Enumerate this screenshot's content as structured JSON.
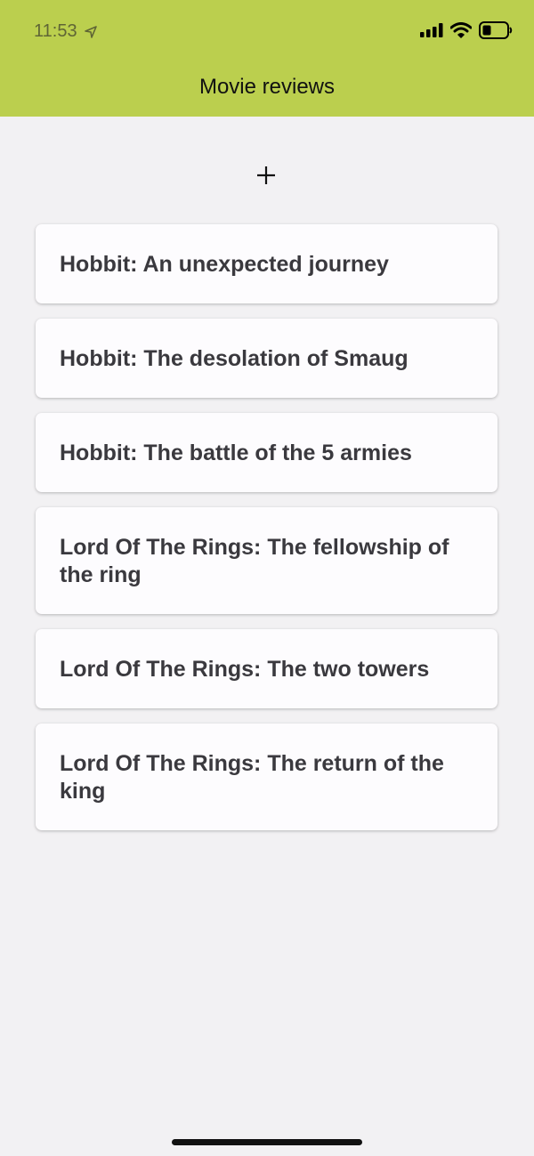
{
  "status_bar": {
    "time": "11:53"
  },
  "header": {
    "title": "Movie reviews",
    "color": "#bbcf4e"
  },
  "add_button": {
    "icon": "plus-icon"
  },
  "movies": [
    {
      "title": "Hobbit: An unexpected journey"
    },
    {
      "title": "Hobbit: The desolation of Smaug"
    },
    {
      "title": "Hobbit: The battle of the 5 armies"
    },
    {
      "title": "Lord Of The Rings: The fellowship of the ring"
    },
    {
      "title": "Lord Of The Rings: The two towers"
    },
    {
      "title": "Lord Of The Rings: The return of the king"
    }
  ]
}
